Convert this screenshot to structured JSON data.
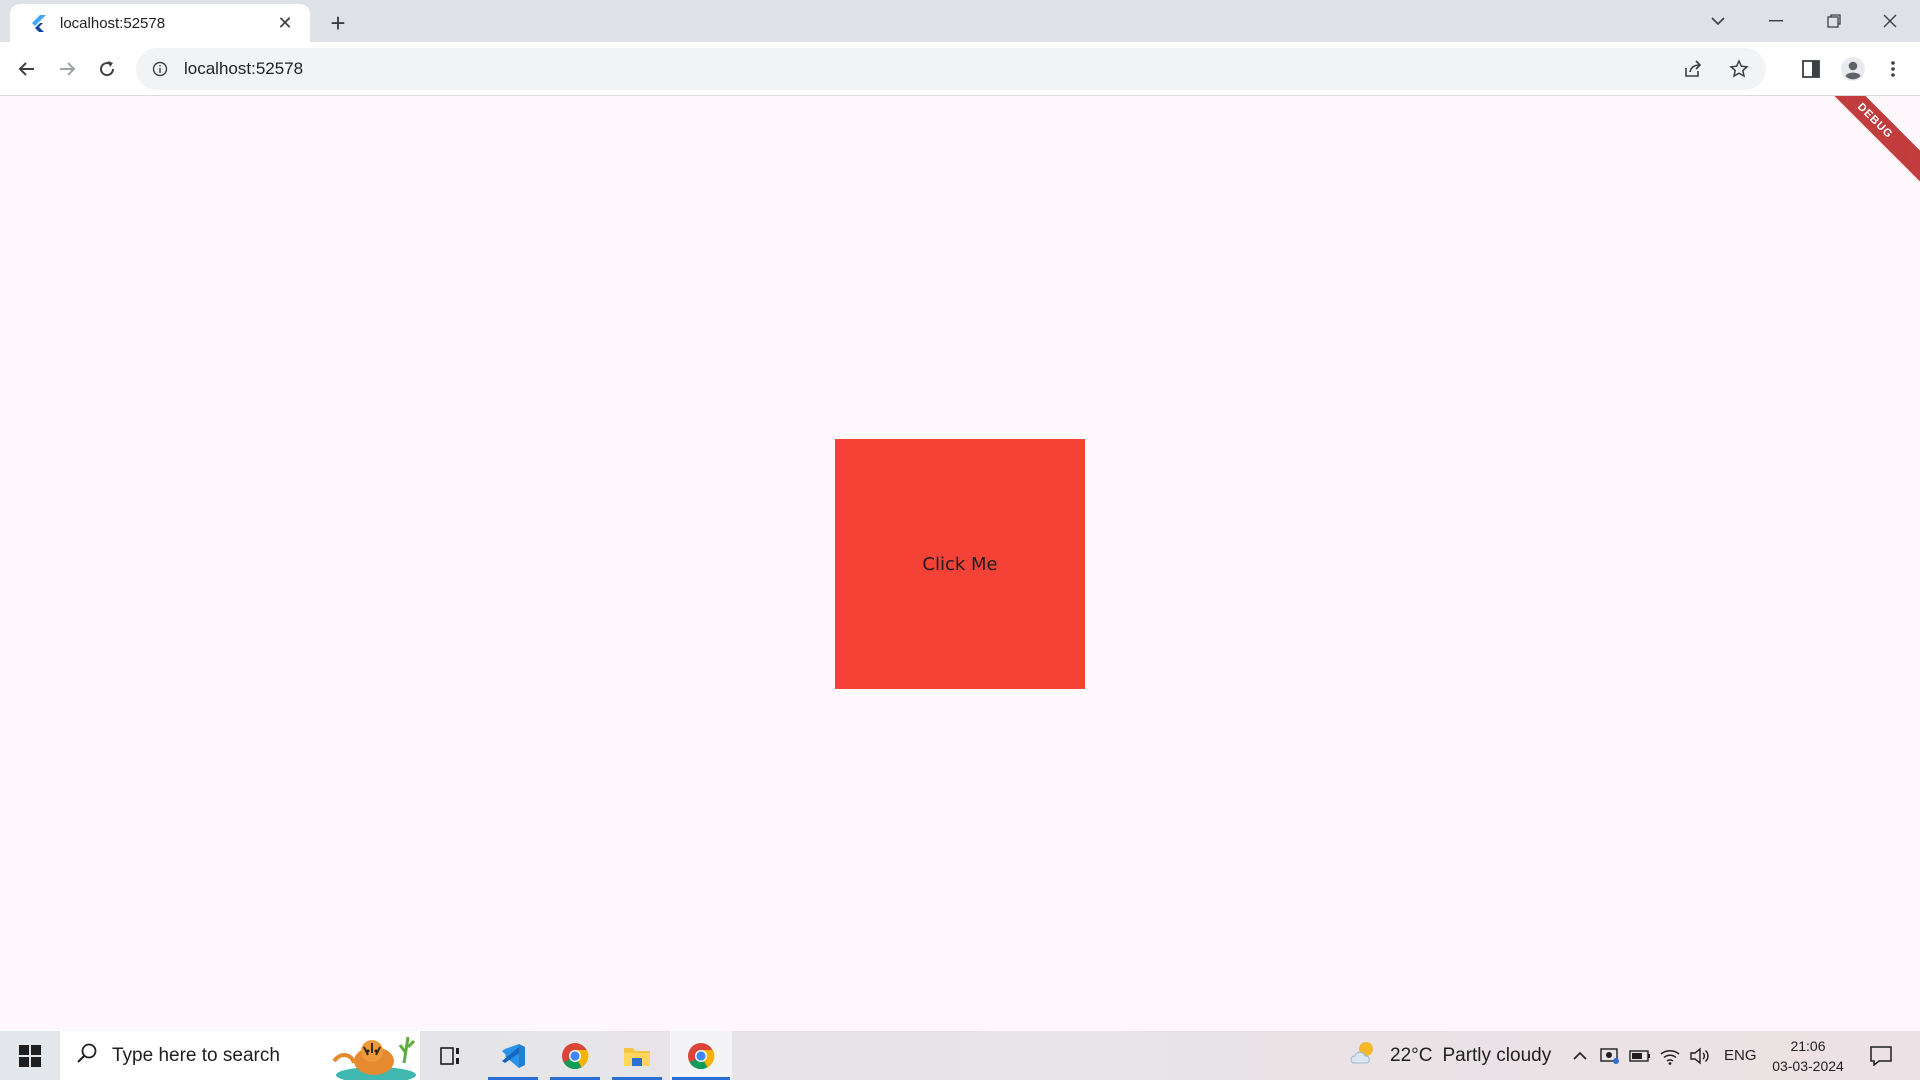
{
  "browser": {
    "tab_title": "localhost:52578",
    "url": "localhost:52578"
  },
  "app": {
    "button_label": "Click Me",
    "button_color": "#f44336",
    "background_color": "#fef7fb",
    "debug_banner": "DEBUG"
  },
  "taskbar": {
    "search_placeholder": "Type here to search",
    "weather_temp": "22°C",
    "weather_desc": "Partly cloudy",
    "language": "ENG",
    "time": "21:06",
    "date": "03-03-2024",
    "apps": [
      "task-view",
      "vscode",
      "chrome",
      "file-explorer",
      "chrome"
    ]
  }
}
